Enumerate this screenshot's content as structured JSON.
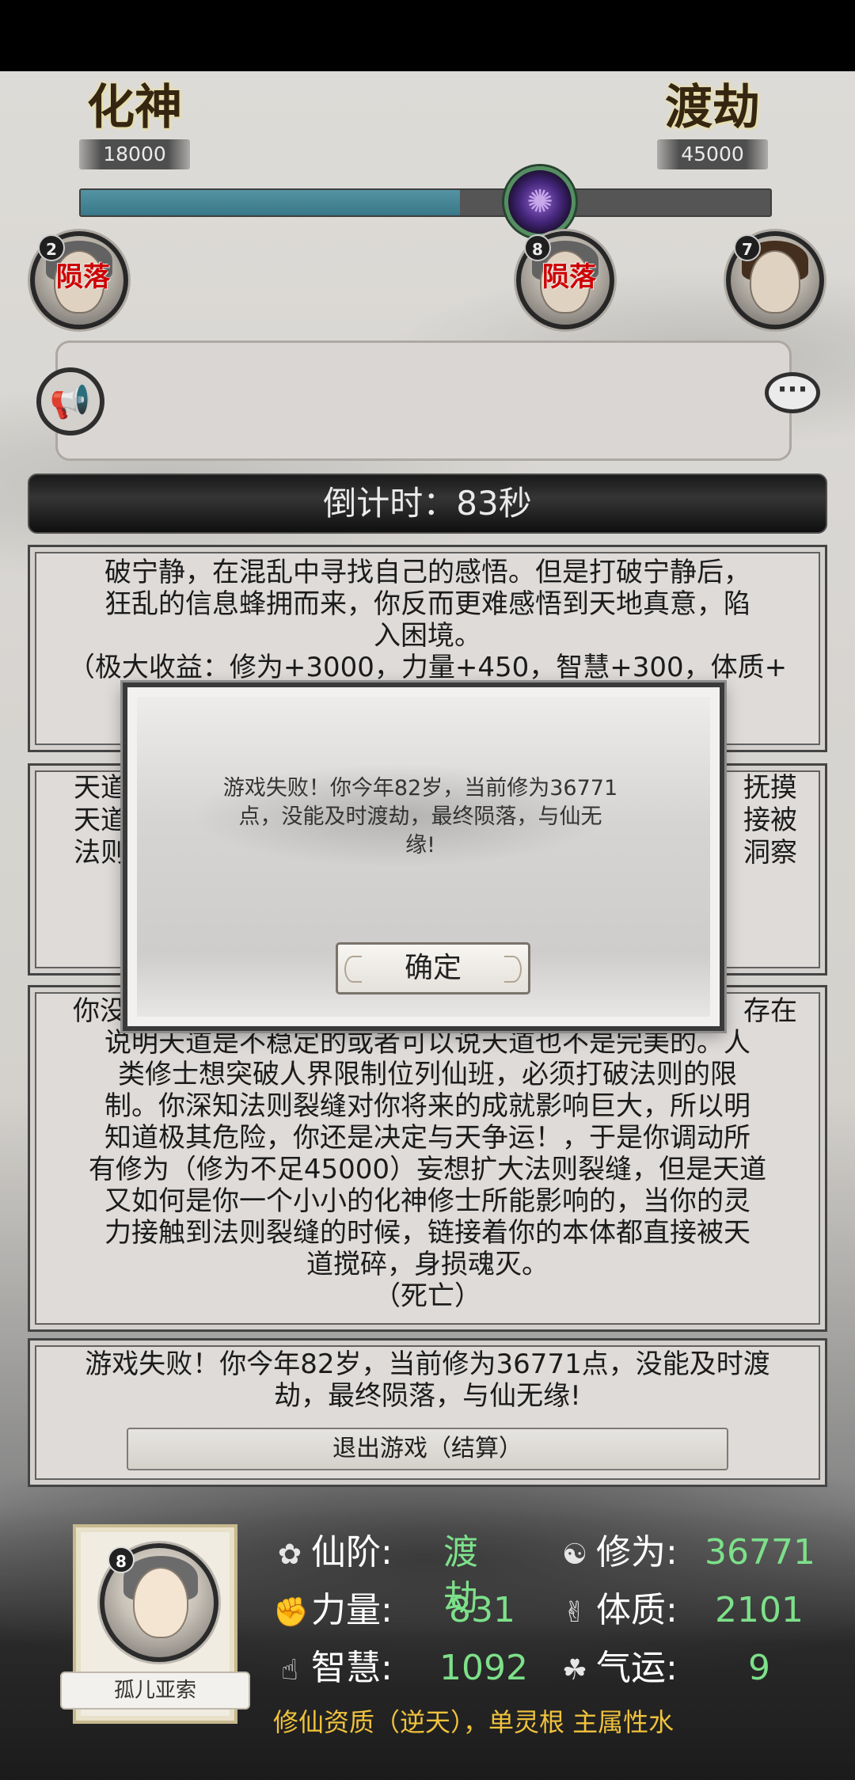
{
  "header": {
    "left_realm": {
      "name": "化神",
      "value": "18000"
    },
    "right_realm": {
      "name": "渡劫",
      "value": "45000"
    },
    "progress_fraction": 0.55
  },
  "players": [
    {
      "badge": "2",
      "status": "陨落"
    },
    {
      "badge": "8",
      "status": "陨落"
    },
    {
      "badge": "7",
      "status": ""
    }
  ],
  "timer": {
    "text": "倒计时：83秒"
  },
  "events": {
    "card1": {
      "lines": [
        "破宁静，在混乱中寻找自己的感悟。但是打破宁静后，",
        "狂乱的信息蜂拥而来，你反而更难感悟到天地真意，陷",
        "入困境。",
        "（极大收益：修为+3000，力量+450，智慧+300，体质+"
      ]
    },
    "card2": {
      "left_lines": [
        "天道",
        "天道",
        "法则"
      ],
      "right_lines": [
        "抚摸",
        "接被",
        "洞察"
      ]
    },
    "card3": {
      "first_left": "你没",
      "first_right": "存在",
      "lines": [
        "说明天道是不稳定的或者可以说天道也不是完美的。人",
        "类修士想突破人界限制位列仙班，必须打破法则的限",
        "制。你深知法则裂缝对你将来的成就影响巨大，所以明",
        "知道极其危险，你还是决定与天争运！，于是你调动所",
        "有修为（修为不足45000）妄想扩大法则裂缝，但是天道",
        "又如何是你一个小小的化神修士所能影响的，当你的灵",
        "力接触到法则裂缝的时候，链接着你的本体都直接被天",
        "道搅碎，身损魂灭。",
        "（死亡）"
      ]
    },
    "card4": {
      "lines": [
        "游戏失败！你今年82岁，当前修为36771点，没能及时渡",
        "劫，最终陨落，与仙无缘!"
      ],
      "exit_button": "退出游戏（结算）"
    }
  },
  "dialog": {
    "lines": [
      "游戏失败！你今年82岁，当前修为36771",
      "点，没能及时渡劫，最终陨落，与仙无",
      "缘!"
    ],
    "ok_button": "确定"
  },
  "player": {
    "badge": "8",
    "name": "孤儿亚索",
    "stats": {
      "realm": {
        "label": "仙阶:",
        "value": "渡劫"
      },
      "cultivation": {
        "label": "修为:",
        "value": "36771"
      },
      "strength": {
        "label": "力量:",
        "value": "831"
      },
      "constitution": {
        "label": "体质:",
        "value": "2101"
      },
      "wisdom": {
        "label": "智慧:",
        "value": "1092"
      },
      "luck": {
        "label": "气运:",
        "value": "9"
      }
    },
    "talent": "修仙资质（逆天），单灵根 主属性水"
  },
  "colors": {
    "progress": "#4a8fa0",
    "stat_value": "#7de08a",
    "talent": "#f0c23c",
    "dead": "#e00000"
  }
}
